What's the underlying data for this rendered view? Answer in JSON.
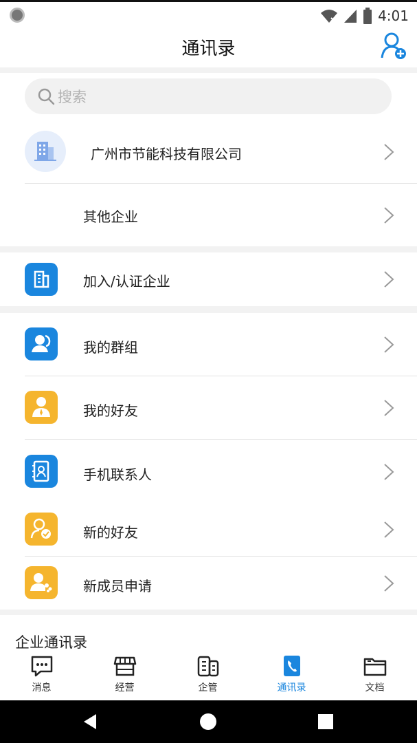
{
  "status_bar": {
    "time": "4:01"
  },
  "header": {
    "title": "通讯录",
    "add_contact_icon": "person-add-icon"
  },
  "search": {
    "placeholder": "搜索"
  },
  "company_list": [
    {
      "label": "广州市节能科技有限公司",
      "icon": "building-icon"
    },
    {
      "label": "其他企业"
    }
  ],
  "join_company": {
    "label": "加入/认证企业",
    "icon": "building-icon",
    "color": "#1a86de"
  },
  "contacts_menu": [
    {
      "label": "我的群组",
      "icon": "group-icon",
      "color": "#1a86de"
    },
    {
      "label": "我的好友",
      "icon": "friend-icon",
      "color": "#f5b52e"
    },
    {
      "label": "手机联系人",
      "icon": "phonebook-icon",
      "color": "#1a86de"
    },
    {
      "label": "新的好友",
      "icon": "new-friend-icon",
      "color": "#f5b52e"
    },
    {
      "label": "新成员申请",
      "icon": "member-apply-icon",
      "color": "#f5b52e"
    }
  ],
  "directory_title": "企业通讯录",
  "tabs": [
    {
      "label": "消息",
      "icon": "chat-icon",
      "active": false
    },
    {
      "label": "经营",
      "icon": "store-icon",
      "active": false
    },
    {
      "label": "企管",
      "icon": "enterprise-icon",
      "active": false
    },
    {
      "label": "通讯录",
      "icon": "contacts-icon",
      "active": true
    },
    {
      "label": "文档",
      "icon": "folder-icon",
      "active": false
    }
  ],
  "colors": {
    "accent": "#1a86de",
    "orange": "#f5b52e"
  }
}
